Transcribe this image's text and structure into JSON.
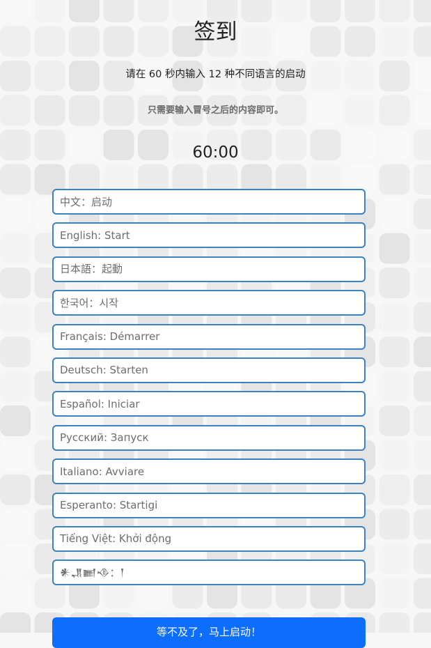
{
  "page": {
    "title": "签到",
    "instruction": "请在 60 秒内输入 12 种不同语言的启动",
    "note": "只需要输入冒号之后的内容即可。",
    "timer": "60:00"
  },
  "inputs": [
    {
      "placeholder": "中文：启动"
    },
    {
      "placeholder": "English: Start"
    },
    {
      "placeholder": "日本語：起動"
    },
    {
      "placeholder": "한국어：시작"
    },
    {
      "placeholder": "Français: Démarrer"
    },
    {
      "placeholder": "Deutsch: Starten"
    },
    {
      "placeholder": "Español: Iniciar"
    },
    {
      "placeholder": "Русский: Запуск"
    },
    {
      "placeholder": "Italiano: Avviare"
    },
    {
      "placeholder": "Esperanto: Startigi"
    },
    {
      "placeholder": "Tiếng Việt: Khởi động"
    },
    {
      "placeholder": "𒀭𒂗𒆤𒈾：𒁹"
    }
  ],
  "submit_label": "等不及了，马上启动！",
  "colors": {
    "input_border": "#3b82c4",
    "button_bg": "#0d6efd",
    "tile_light": "#f1f1f1",
    "tile_dark": "#e4e4e4"
  }
}
